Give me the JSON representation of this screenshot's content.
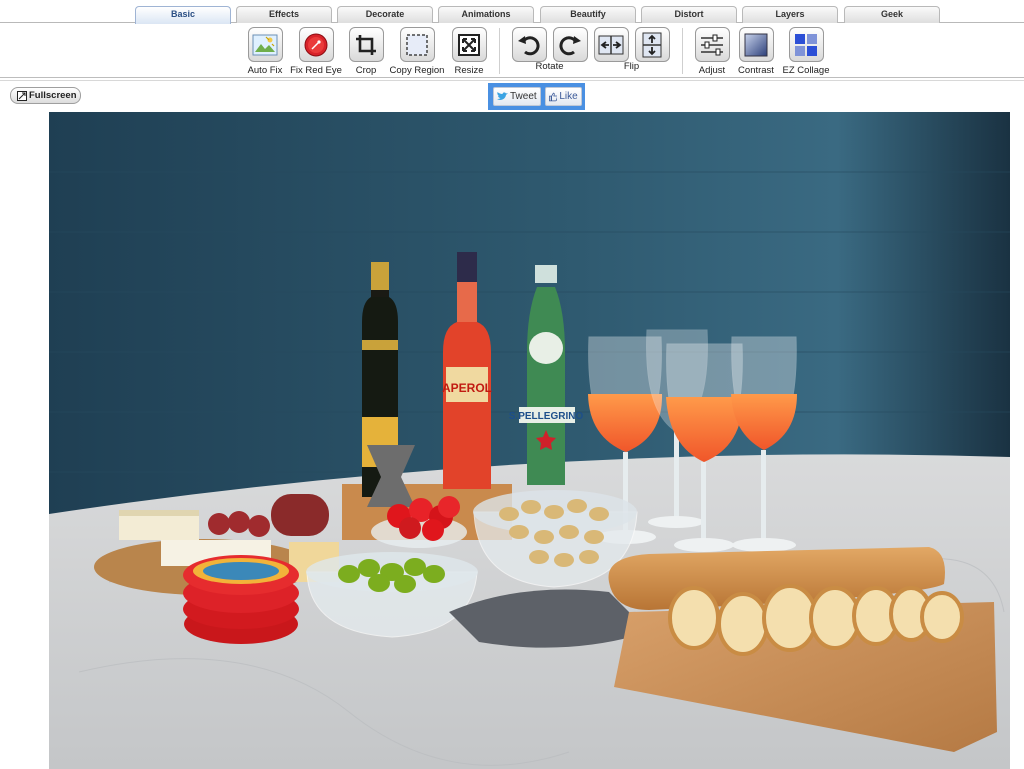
{
  "tabs": [
    {
      "label": "Basic",
      "active": true
    },
    {
      "label": "Effects"
    },
    {
      "label": "Decorate"
    },
    {
      "label": "Animations"
    },
    {
      "label": "Beautify"
    },
    {
      "label": "Distort"
    },
    {
      "label": "Layers"
    },
    {
      "label": "Geek"
    }
  ],
  "tools": {
    "auto_fix": "Auto Fix",
    "fix_red_eye": "Fix Red Eye",
    "crop": "Crop",
    "copy_region": "Copy Region",
    "resize": "Resize",
    "rotate": "Rotate",
    "flip": "Flip",
    "adjust": "Adjust",
    "contrast": "Contrast",
    "ez_collage": "EZ Collage"
  },
  "fullscreen_label": "Fullscreen",
  "social": {
    "tweet": "Tweet",
    "like": "Like"
  },
  "photo": {
    "bottle_label_aperol": "APEROL",
    "bottle_label_pellegrino": "S.PELLEGRINO"
  },
  "colors": {
    "wall": "#2d5468",
    "tab_active": "#2b4f84",
    "social_frame": "#4a90e2"
  }
}
